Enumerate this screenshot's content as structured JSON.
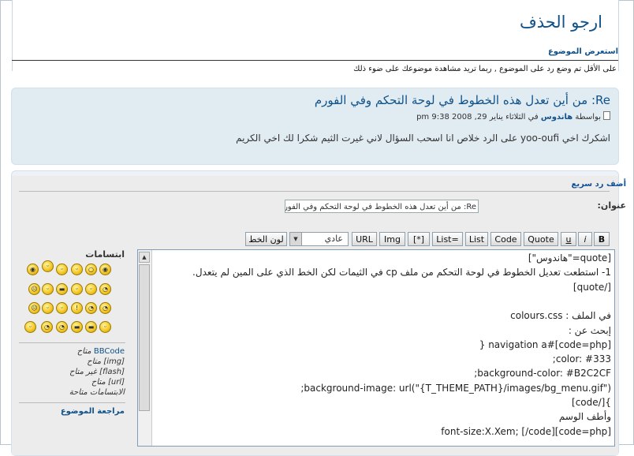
{
  "page": {
    "title": "ارجو الحذف",
    "view_topic_link": "استعرض الموضوع",
    "notice": "على الأقل تم وضع رد على الموضوع , ربما تريد مشاهدة موضوعك على ضوء ذلك"
  },
  "post": {
    "title": "Re: من أين تعدل هذه الخطوط في لوحة التحكم وفي الفورم",
    "by_label": "بواسطة",
    "author": "هاندوس",
    "date": "في الثلاثاء يناير 29, 2008 9:38 pm",
    "body": "اشكرك اخي yoo-oufi على الرد خلاص انا اسحب السؤال لاني غيرت الثيم شكرا لك اخي الكريم"
  },
  "quick_reply": {
    "title": "أضف رد سريع",
    "subject_label": "عنوان:",
    "subject_value": "Re: من أين تعدل هذه الخطوط في لوحة التحكم وفي الفورم",
    "toolbar": {
      "bold": "B",
      "italic": "i",
      "underline": "u",
      "quote": "Quote",
      "code": "Code",
      "list": "List",
      "list_ordered": "List=",
      "list_item": "[*]",
      "img": "Img",
      "url": "URL",
      "font_size_value": "عادي",
      "font_color": "لون الخط"
    },
    "emoticons_label": "ابتسامات",
    "status": {
      "bbcode_link": "BBCode",
      "bbcode_state": "متاح",
      "img": "[img] متاح",
      "flash": "[flash] غير متاح",
      "url": "[url] متاح",
      "smilies": "الابتسامات متاحة"
    },
    "review_link": "مراجعة الموضوع",
    "message_lines": [
      "[quote=\"هاندوس\"]",
      "1- استطعت تعديل الخطوط في لوحة التحكم من ملف cp في الثيمات لكن الخط الذي على المين لم يتعدل.",
      "[/quote]",
      "",
      "في الملف : colours.css",
      "إبحث عن :",
      "[code=php]#navigation a {",
      "color: #333;",
      "background-color: #B2C2CF;",
      "background-image: url(\"{T_THEME_PATH}/images/bg_menu.gif\");",
      "}[/code]",
      "وأطف الوسم",
      "[code=php]font-size:X.Xem; [/code]"
    ]
  },
  "colors": {
    "link": "#105289",
    "post_bg": "#e1ebf2",
    "form_bg": "#ececec"
  }
}
